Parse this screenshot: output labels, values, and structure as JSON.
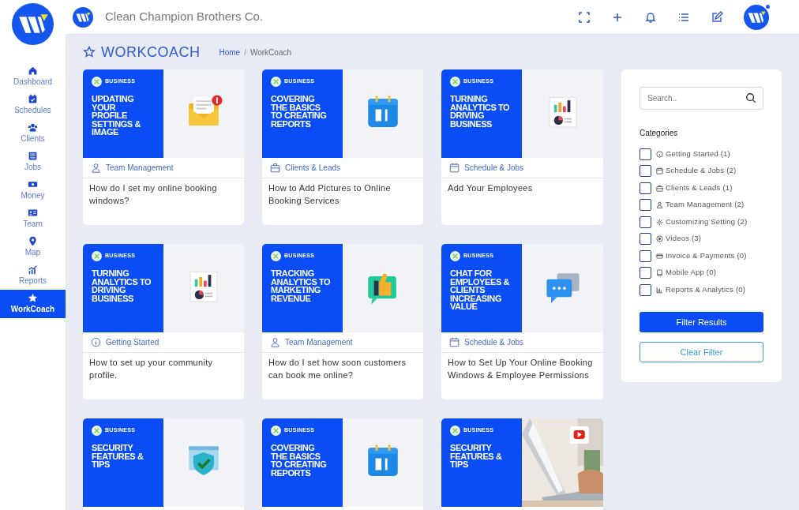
{
  "sidebar": {
    "items": [
      {
        "kind": "home",
        "label": "Dashboard",
        "selected": false
      },
      {
        "kind": "calendar",
        "label": "Schedules",
        "selected": false
      },
      {
        "kind": "users",
        "label": "Clients",
        "selected": false
      },
      {
        "kind": "list",
        "label": "Jobs",
        "selected": false
      },
      {
        "kind": "money",
        "label": "Money",
        "selected": false
      },
      {
        "kind": "idcard",
        "label": "Team",
        "selected": false
      },
      {
        "kind": "pin",
        "label": "Map",
        "selected": false
      },
      {
        "kind": "chart",
        "label": "Reports",
        "selected": false
      },
      {
        "kind": "star",
        "label": "WorkCoach",
        "selected": true
      }
    ]
  },
  "top_bar": {
    "company": "Clean Champion Brothers Co."
  },
  "page": {
    "title": "WORKCOACH",
    "breadcrumb": {
      "items": [
        "Home",
        "WorkCoach"
      ],
      "separator": "/"
    }
  },
  "cards": [
    {
      "tag": "BUSINESS",
      "thumb_title": "UPDATING YOUR PROFILE SETTINGS & IMAGE",
      "kind": "envelope",
      "category": {
        "kind": "user",
        "label": "Team Management"
      },
      "title": "How do I set my online booking windows?"
    },
    {
      "tag": "BUSINESS",
      "thumb_title": "COVERING THE BASICS TO CREATING REPORTS",
      "kind": "calendar",
      "category": {
        "kind": "briefcase",
        "label": "Clients & Leads"
      },
      "title": "How to Add Pictures to Online Booking Services"
    },
    {
      "tag": "BUSINESS",
      "thumb_title": "TURNING ANALYTICS TO DRIVING BUSINESS",
      "kind": "report",
      "category": {
        "kind": "calendar",
        "label": "Schedule & Jobs"
      },
      "title": "Add Your Employees"
    },
    {
      "tag": "BUSINESS",
      "thumb_title": "TURNING ANALYTICS TO DRIVING BUSINESS",
      "kind": "report",
      "category": {
        "kind": "info",
        "label": "Getting Started"
      },
      "title": "How to set up your community profile."
    },
    {
      "tag": "BUSINESS",
      "thumb_title": "TRACKING ANALYTICS TO MARKETING REVENUE",
      "kind": "thumb",
      "category": {
        "kind": "user",
        "label": "Team Management"
      },
      "title": "How do I set how soon customers can book me online?"
    },
    {
      "tag": "BUSINESS",
      "thumb_title": "CHAT FOR EMPLOYEES & CLIENTS INCREASING VALUE",
      "kind": "chat",
      "category": {
        "kind": "calendar",
        "label": "Schedule & Jobs"
      },
      "title": "How to Set Up Your Online Booking Windows & Employee Permissions"
    },
    {
      "tag": "BUSINESS",
      "thumb_title": "SECURITY FEATURES & TIPS",
      "kind": "shield"
    },
    {
      "tag": "BUSINESS",
      "thumb_title": "COVERING THE BASICS TO CREATING REPORTS",
      "kind": "calendar"
    },
    {
      "tag": "BUSINESS",
      "thumb_title": "SECURITY FEATURES & TIPS",
      "kind": "picture"
    }
  ],
  "filter": {
    "search": {
      "placeholder": "Search.."
    },
    "heading": "Categories",
    "categories": [
      {
        "kind": "info",
        "label": "Getting Started (1)",
        "checked": false
      },
      {
        "kind": "calendar",
        "label": "Schedule & Jobs (2)",
        "checked": false
      },
      {
        "kind": "briefcase",
        "label": "Clients & Leads (1)",
        "checked": false
      },
      {
        "kind": "user",
        "label": "Team Management (2)",
        "checked": false
      },
      {
        "kind": "gear",
        "label": "Customizing Setting (2)",
        "checked": false
      },
      {
        "kind": "play",
        "label": "Videos (3)",
        "checked": false
      },
      {
        "kind": "card",
        "label": "Invoice & Payments (0)",
        "checked": false
      },
      {
        "kind": "tablet",
        "label": "Mobile App (0)",
        "checked": false
      },
      {
        "kind": "bars",
        "label": "Reports & Analytics (0)",
        "checked": false
      }
    ],
    "buttons": [
      "Filter Results",
      "Clear Filter"
    ]
  }
}
